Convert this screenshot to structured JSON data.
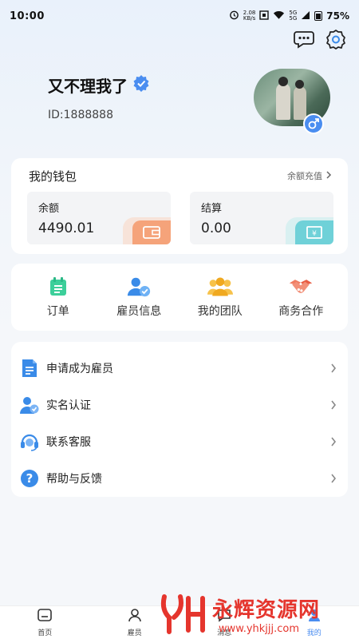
{
  "status_bar": {
    "time": "10:00",
    "net_speed_top": "2.08",
    "net_speed_bottom": "KB/s",
    "signal1": "5G",
    "signal2": "5G",
    "battery": "75%"
  },
  "profile": {
    "name": "又不理我了",
    "id": "ID:1888888"
  },
  "wallet": {
    "title": "我的钱包",
    "recharge": "余额充值",
    "balance_label": "余额",
    "balance_value": "4490.01",
    "settle_label": "结算",
    "settle_value": "0.00"
  },
  "menu": [
    {
      "label": "订单",
      "icon": "order-icon"
    },
    {
      "label": "雇员信息",
      "icon": "employee-info-icon"
    },
    {
      "label": "我的团队",
      "icon": "team-icon"
    },
    {
      "label": "商务合作",
      "icon": "handshake-icon"
    }
  ],
  "list": [
    {
      "label": "申请成为雇员",
      "icon": "document-icon"
    },
    {
      "label": "实名认证",
      "icon": "verify-user-icon"
    },
    {
      "label": "联系客服",
      "icon": "headset-icon"
    },
    {
      "label": "帮助与反馈",
      "icon": "help-icon"
    }
  ],
  "tabs": [
    {
      "label": "首页",
      "icon": "home-icon"
    },
    {
      "label": "雇员",
      "icon": "user-icon"
    },
    {
      "label": "消息",
      "icon": "message-icon"
    },
    {
      "label": "我的",
      "icon": "profile-icon"
    }
  ],
  "watermark": {
    "title": "永辉资源网",
    "url": "www.yhkjjj.com"
  },
  "colors": {
    "accent": "#4a8df0",
    "wallet_orange": "#f5a37a",
    "wallet_teal": "#6fd1d8",
    "watermark_red": "#e5352d"
  }
}
